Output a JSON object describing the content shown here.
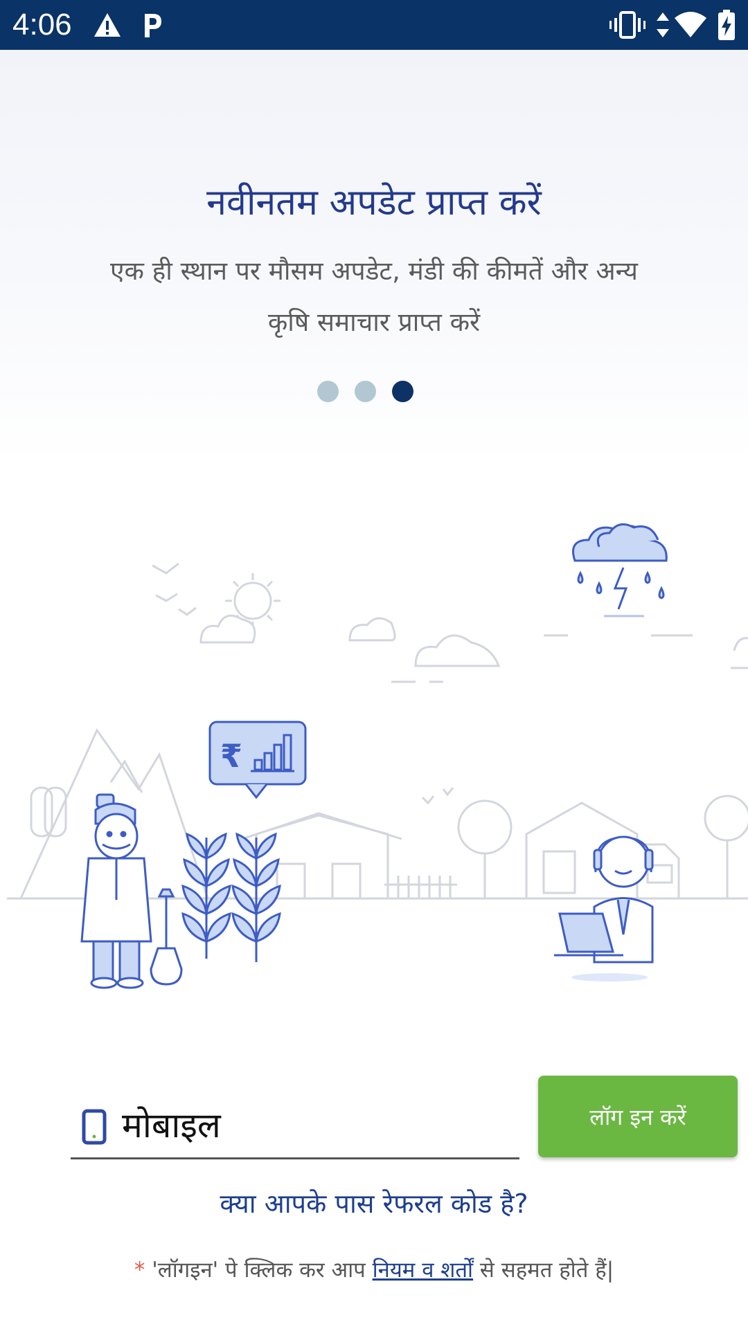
{
  "status_bar": {
    "time": "4:06",
    "left_icons": [
      "warning-icon",
      "parking-icon"
    ],
    "right_icons": [
      "vibrate-icon",
      "data-arrows-icon",
      "wifi-icon",
      "battery-charging-icon"
    ]
  },
  "onboarding": {
    "title": "नवीनतम अपडेट प्राप्त करें",
    "subtitle_line1": "एक ही स्थान पर मौसम अपडेट, मंडी की कीमतें और अन्य",
    "subtitle_line2": "कृषि समाचार प्राप्त करें",
    "page_count": 3,
    "active_page": 3
  },
  "illustration": {
    "rupee_symbol": "₹",
    "icons": [
      "farmer-illustration",
      "crop-plant-icon",
      "price-chart-bubble-icon",
      "support-agent-illustration",
      "storm-cloud-icon",
      "sun-icon"
    ]
  },
  "login": {
    "mobile_placeholder": "मोबाइल",
    "mobile_value": "",
    "button_label": "लॉग इन करें",
    "referral_text": "क्या आपके पास रेफरल कोड है?",
    "terms_star": "*",
    "terms_prefix": " 'लॉगइन' पे क्लिक कर आप ",
    "terms_link": "नियम व शर्तों",
    "terms_suffix": " से सहमत होते हैं|"
  },
  "colors": {
    "status_bar": "#0a3367",
    "title": "#233a8c",
    "login_button": "#6ab842",
    "dot_active": "#0c3266",
    "dot_inactive": "#b2c7d1",
    "illustration_blue": "#3d5cc4"
  }
}
